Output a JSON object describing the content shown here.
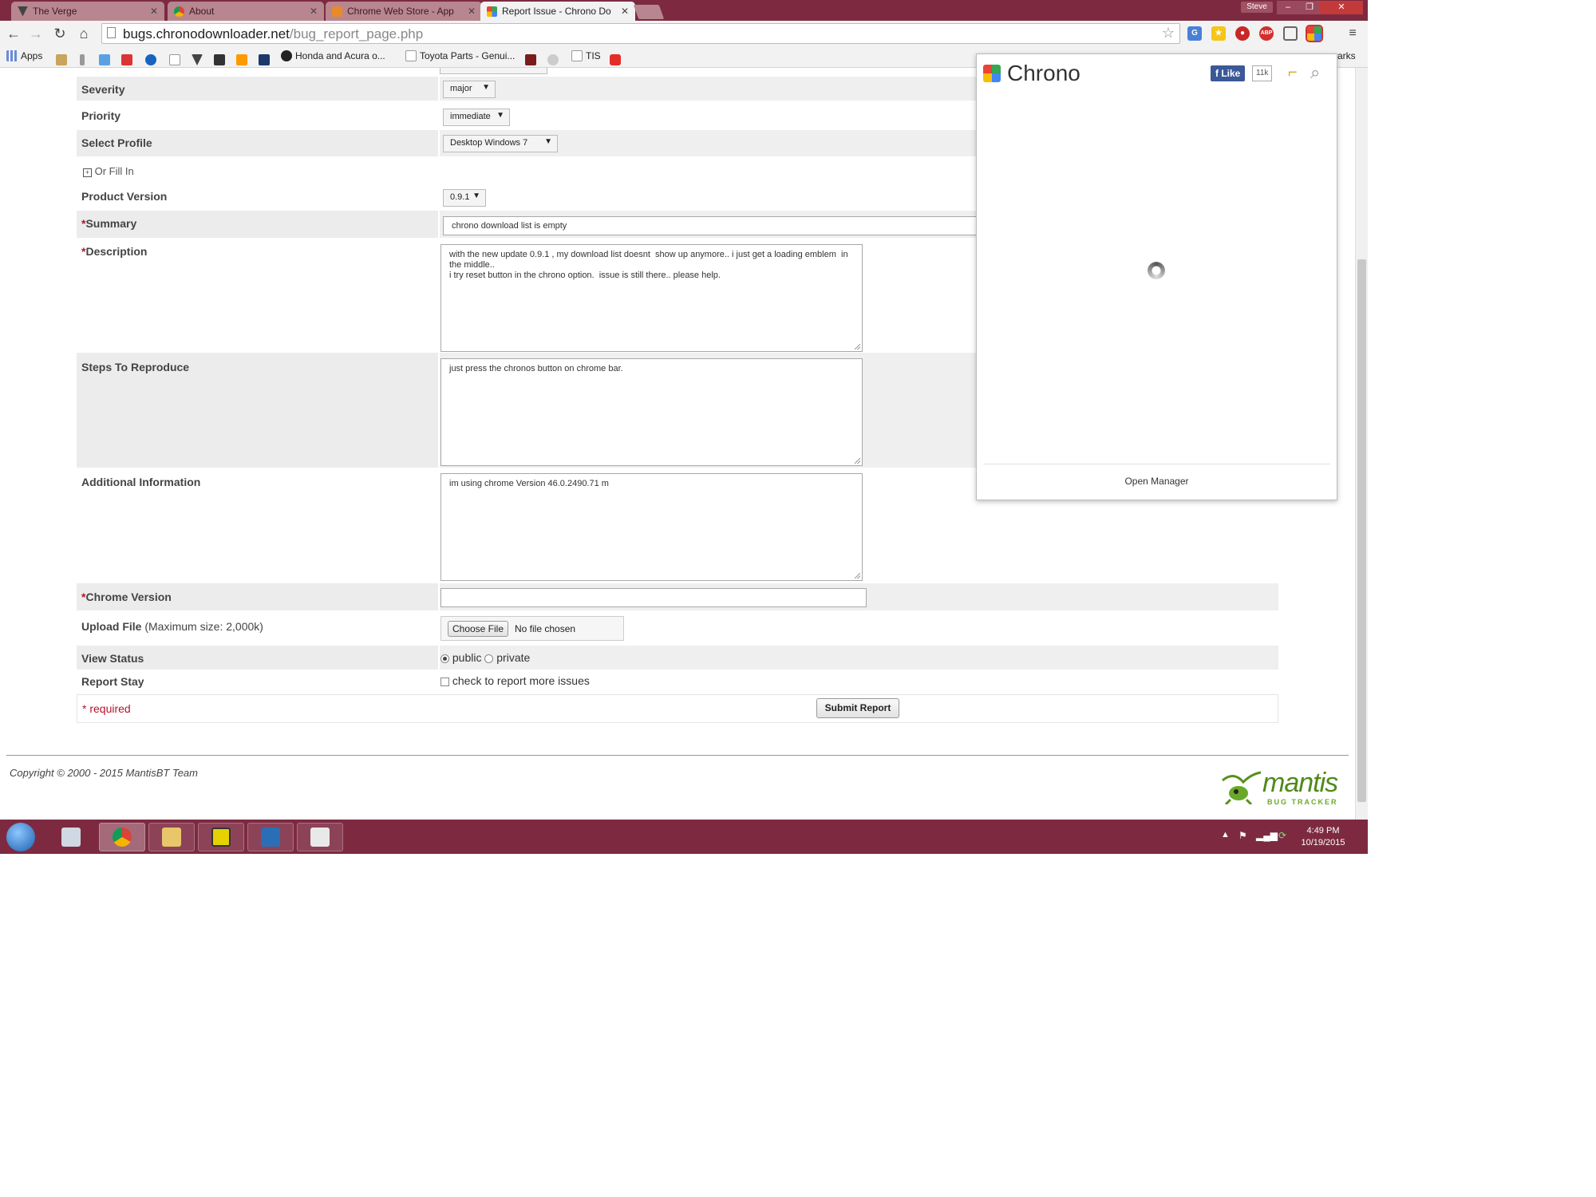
{
  "browser": {
    "tabs": [
      {
        "label": "The Verge",
        "active": false
      },
      {
        "label": "About",
        "active": false
      },
      {
        "label": "Chrome Web Store - App",
        "active": false
      },
      {
        "label": "Report Issue - Chrono Do",
        "active": true
      }
    ],
    "user": "Steve",
    "url_host": "bugs.chronodownloader.net",
    "url_path": "/bug_report_page.php",
    "bookmarks": {
      "apps": "Apps",
      "honda": "Honda and Acura o...",
      "toyota": "Toyota Parts - Genui...",
      "tis": "TIS",
      "other": "arks"
    },
    "ext_abp": "ABP"
  },
  "form": {
    "severity": {
      "label": "Severity",
      "value": "major"
    },
    "priority": {
      "label": "Priority",
      "value": "immediate"
    },
    "profile": {
      "label": "Select Profile",
      "value": "Desktop Windows 7"
    },
    "or_fill_in": "Or Fill In",
    "product_version": {
      "label": "Product Version",
      "value": "0.9.1"
    },
    "summary": {
      "label": "Summary",
      "value": "chrono download list is empty"
    },
    "description": {
      "label": "Description",
      "value": "with the new update 0.9.1 , my download list doesnt  show up anymore.. i just get a loading emblem  in the middle..\ni try reset button in the chrono option.  issue is still there.. please help."
    },
    "steps": {
      "label": "Steps To Reproduce",
      "value": "just press the chronos button on chrome bar."
    },
    "additional": {
      "label": "Additional Information",
      "value": "im using chrome Version 46.0.2490.71 m"
    },
    "chrome_version": {
      "label": "Chrome Version",
      "value": ""
    },
    "upload": {
      "label": "Upload File",
      "note": "(Maximum size: 2,000k)",
      "button": "Choose File",
      "status": "No file chosen"
    },
    "view_status": {
      "label": "View Status",
      "public": "public",
      "private": "private",
      "selected": "public"
    },
    "report_stay": {
      "label": "Report Stay",
      "text": "check to report more issues",
      "checked": false
    },
    "required_note": "* required",
    "submit": "Submit Report",
    "required_mark": "*"
  },
  "footer": {
    "copyright": "Copyright © 2000 - 2015 MantisBT Team",
    "logo_main": "mantis",
    "logo_sub": "BUG TRACKER"
  },
  "popup": {
    "title": "Chrono",
    "like": "Like",
    "like_count": "11k",
    "open_manager": "Open Manager"
  },
  "taskbar": {
    "time": "4:49 PM",
    "date": "10/19/2015"
  },
  "colors": {
    "accent": "#7d2a41",
    "required": "#b5122c",
    "facebook": "#3b5998"
  }
}
